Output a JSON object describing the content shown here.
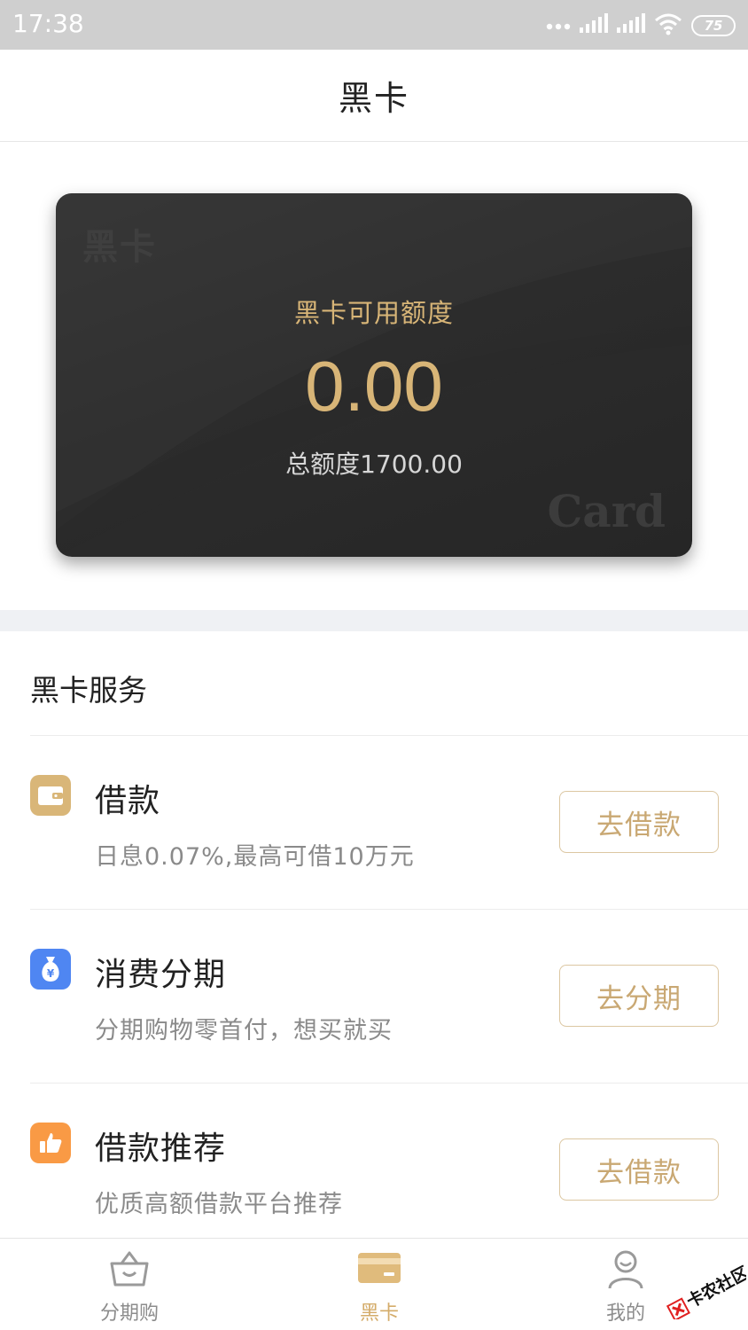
{
  "status_bar": {
    "time": "17:38",
    "battery": "75",
    "icons": [
      "more-dots-icon",
      "signal-icon",
      "signal-icon",
      "wifi-icon",
      "battery-icon"
    ]
  },
  "header": {
    "title": "黑卡"
  },
  "card": {
    "watermark_cn": "黑卡",
    "watermark_en": "Card",
    "label": "黑卡可用额度",
    "amount": "0.00",
    "total": "总额度1700.00"
  },
  "services": {
    "section_title": "黑卡服务",
    "items": [
      {
        "icon": "wallet-icon",
        "icon_color": "#d9b678",
        "title": "借款",
        "desc": "日息0.07%,最高可借10万元",
        "button": "去借款"
      },
      {
        "icon": "money-bag-icon",
        "icon_color": "#4f86f2",
        "title": "消费分期",
        "desc": "分期购物零首付，想买就买",
        "button": "去分期"
      },
      {
        "icon": "thumbs-up-icon",
        "icon_color": "#f99a45",
        "title": "借款推荐",
        "desc": "优质高额借款平台推荐",
        "button": "去借款"
      }
    ]
  },
  "tabs": [
    {
      "label": "分期购",
      "icon": "basket-icon",
      "active": false
    },
    {
      "label": "黑卡",
      "icon": "card-icon",
      "active": true
    },
    {
      "label": "我的",
      "icon": "user-icon",
      "active": false
    }
  ],
  "colors": {
    "accent_gold": "#d4ac6a",
    "card_bg": "#2c2c2c",
    "band": "#eff1f4"
  },
  "watermark_logo": "卡农社区"
}
